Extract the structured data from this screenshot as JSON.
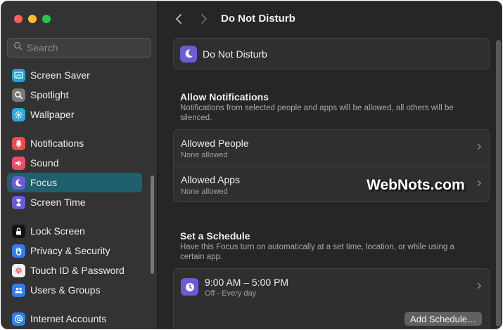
{
  "sidebar": {
    "search_placeholder": "Search",
    "items": [
      {
        "label": "Screen Saver",
        "icon": "screen-saver-icon",
        "color": "#1aa6d6"
      },
      {
        "label": "Spotlight",
        "icon": "spotlight-icon",
        "color": "#7a7a7a"
      },
      {
        "label": "Wallpaper",
        "icon": "wallpaper-icon",
        "color": "#2ea7e0"
      },
      {
        "label": "Notifications",
        "icon": "notifications-icon",
        "color": "#ee4b4b"
      },
      {
        "label": "Sound",
        "icon": "sound-icon",
        "color": "#ee4b6b"
      },
      {
        "label": "Focus",
        "icon": "focus-moon-icon",
        "color": "#6a5bd6",
        "active": true
      },
      {
        "label": "Screen Time",
        "icon": "screen-time-icon",
        "color": "#6a5bd6"
      },
      {
        "label": "Lock Screen",
        "icon": "lock-screen-icon",
        "color": "#111111"
      },
      {
        "label": "Privacy & Security",
        "icon": "privacy-hand-icon",
        "color": "#2f7df0"
      },
      {
        "label": "Touch ID & Password",
        "icon": "touch-id-icon",
        "color": "#f2f2f2"
      },
      {
        "label": "Users & Groups",
        "icon": "users-groups-icon",
        "color": "#2f7df0"
      },
      {
        "label": "Internet Accounts",
        "icon": "internet-accounts-icon",
        "color": "#2f7df0"
      }
    ]
  },
  "main": {
    "title": "Do Not Disturb",
    "focus_card_label": "Do Not Disturb",
    "allow": {
      "title": "Allow Notifications",
      "desc": "Notifications from selected people and apps will be allowed, all others will be silenced.",
      "people_title": "Allowed People",
      "people_sub": "None allowed",
      "apps_title": "Allowed Apps",
      "apps_sub": "None allowed"
    },
    "schedule": {
      "title": "Set a Schedule",
      "desc": "Have this Focus turn on automatically at a set time, location, or while using a certain app.",
      "time": "9:00 AM – 5:00 PM",
      "sub": "Off - Every day",
      "add_label": "Add Schedule…"
    }
  },
  "watermark": "WebNots.com",
  "colors": {
    "accent": "#6a5bd6",
    "selection": "#1f5f6e"
  }
}
